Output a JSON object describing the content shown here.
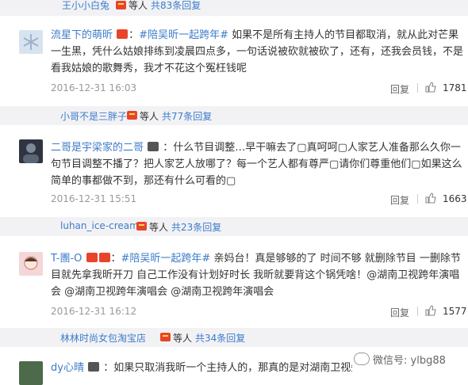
{
  "replies": [
    {
      "user": "王小小白兔",
      "mid": "等人",
      "count": "共83条回复"
    },
    {
      "user": "小哥不是三胖子",
      "mid": "等人",
      "count": "共77条回复"
    },
    {
      "user": "luhan_ice-cream",
      "mid": "等人",
      "count": "共23条回复"
    },
    {
      "user": "林林时尚女包淘宝店",
      "mid": "等人",
      "count": "共34条回复"
    }
  ],
  "comments": [
    {
      "user": "流星下的萌昕",
      "tag": "#陪吴昕一起跨年#",
      "text": "如果不是所有主持人的节目都取消，就从此对芒果一生黑，凭什么姑娘排练到凌晨四点多，一句话说被砍就被砍了，还有，还我会员钱，不是看我姑娘的歌舞秀，我才不花这个冤枉钱呢",
      "time": "2016-12-31 16:03",
      "reply": "回复",
      "likes": "1781"
    },
    {
      "user": "二哥是宇梁家的二哥",
      "tag": "",
      "text": "：什么节目调整…早干嘛去了▢真呵呵▢人家艺人准备那么久你一句节目调整不播了？把人家艺人放哪了？每一个艺人都有尊严▢请你们尊重他们▢如果这么简单的事都做不到，那还有什么可看的▢",
      "time": "2016-12-31 15:51",
      "reply": "回复",
      "likes": "1663"
    },
    {
      "user": "T-團-O",
      "tag": "#陪吴昕一起跨年#",
      "text": "亲妈台！真是够够的了 时间不够 就删除节目 一删除节目就先拿我昕开刀 自己工作没有计划好时长 我昕就要背这个锅凭啥！@湖南卫视跨年演唱会 @湖南卫视跨年演唱会 @湖南卫视跨年演唱会",
      "time": "2016-12-31 16:12",
      "reply": "回复",
      "likes": "1577"
    },
    {
      "user": "dy心晴",
      "tag": "",
      "text": "：如果只取消我昕一个主持人的，那真的是对湖南卫视失望透顶"
    }
  ],
  "watermark": "微信号: ylbg88",
  "colors": {
    "link": "#3d7cc9",
    "badge": "#e8442c",
    "strip": "#f2f2f5"
  }
}
